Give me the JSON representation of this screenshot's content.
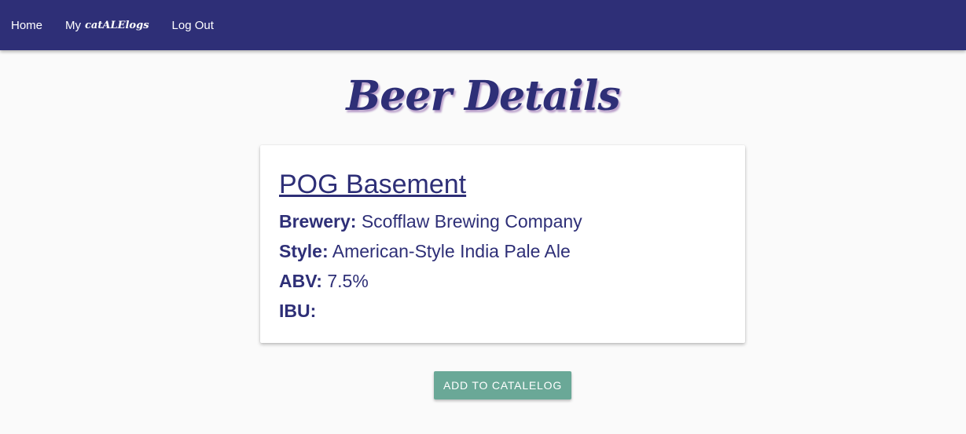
{
  "nav": {
    "home_label": "Home",
    "my_label": "My",
    "catalelogs_brand": "catALElogs",
    "logout_label": "Log Out"
  },
  "page": {
    "title": "Beer Details"
  },
  "beer": {
    "name": "POG Basement",
    "brewery_label": "Brewery:",
    "brewery_value": "Scofflaw Brewing Company",
    "style_label": "Style:",
    "style_value": "American-Style India Pale Ale",
    "abv_label": "ABV:",
    "abv_value": "7.5%",
    "ibu_label": "IBU:",
    "ibu_value": ""
  },
  "actions": {
    "add_label": "ADD TO CATALELOG"
  },
  "colors": {
    "navbar_bg": "#2e2f77",
    "primary_text": "#2e2f77",
    "button_bg": "#6aa897"
  }
}
